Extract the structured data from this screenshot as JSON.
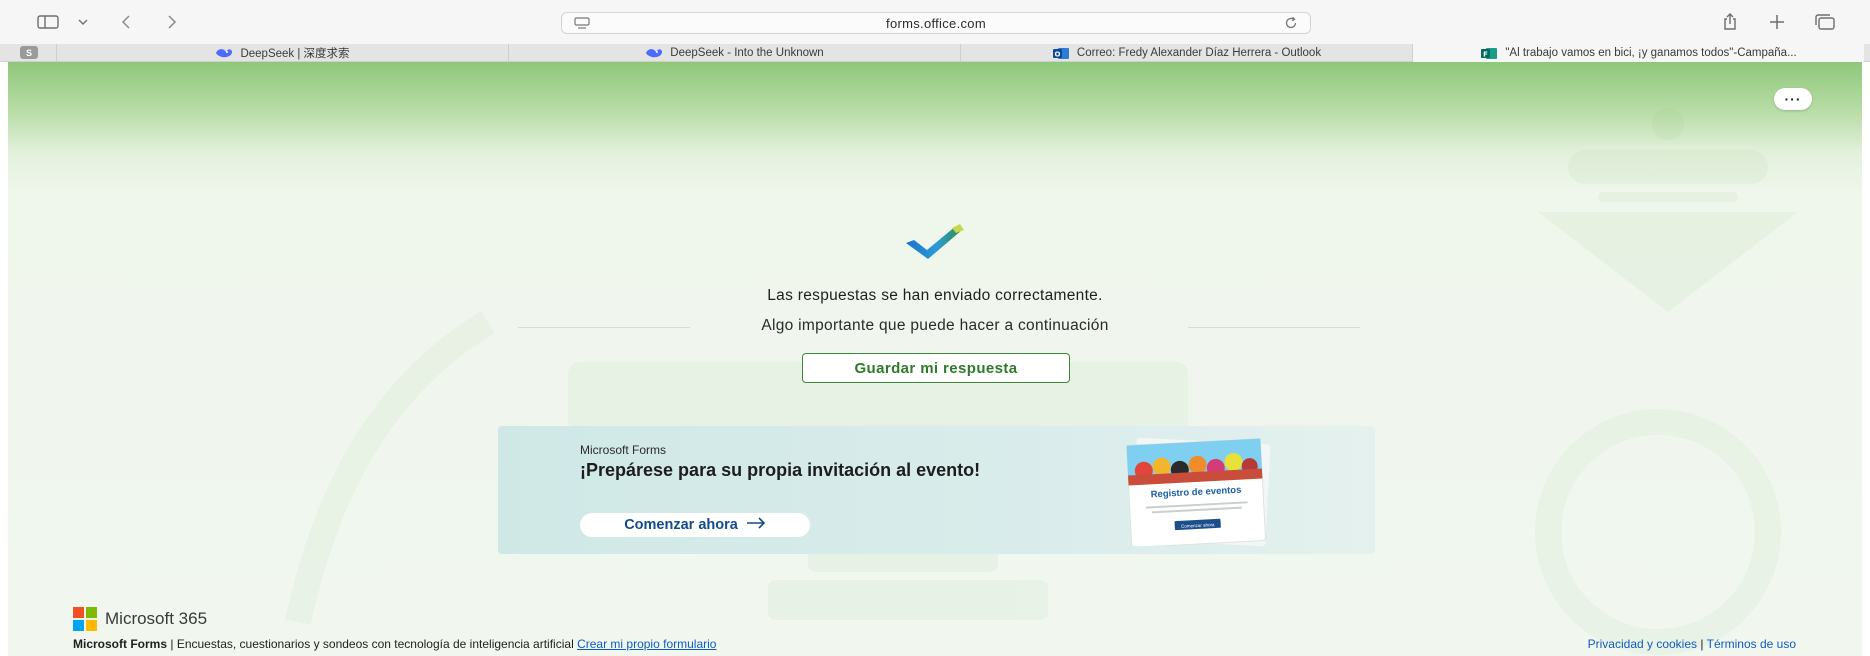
{
  "browser": {
    "url": "forms.office.com",
    "tabs": [
      {
        "label": "DeepSeek | 深度求索",
        "icon": "deepseek-icon"
      },
      {
        "label": "DeepSeek - Into the Unknown",
        "icon": "deepseek-icon"
      },
      {
        "label": "Correo: Fredy Alexander Díaz Herrera - Outlook",
        "icon": "outlook-icon"
      },
      {
        "label": "\"Al trabajo vamos en bici, ¡y ganamos todos\"-Campaña...",
        "icon": "forms-icon",
        "active": true
      }
    ],
    "pinned_tab_label": "S"
  },
  "page": {
    "more_button_label": "···",
    "confirmation": "Las respuestas se han enviado correctamente.",
    "next_step": "Algo importante que puede hacer a continuación",
    "save_button_label": "Guardar mi respuesta"
  },
  "promo": {
    "brand": "Microsoft Forms",
    "title": "¡Prepárese para su propia invitación al evento!",
    "cta_label": "Comenzar ahora",
    "card_title": "Registro de eventos",
    "card_button": "Comenzar ahora"
  },
  "footer": {
    "brand": "Microsoft 365",
    "product": "Microsoft Forms",
    "tagline": "Encuestas, cuestionarios y sondeos con tecnología de inteligencia artificial",
    "create_link": "Crear mi propio formulario",
    "privacy_link": "Privacidad y cookies",
    "terms_link": "Términos de uso",
    "separator": "|"
  },
  "colors": {
    "accent_green": "#2f7a2b",
    "link_blue": "#0f5cc0",
    "header_green": "#8fc77a"
  }
}
